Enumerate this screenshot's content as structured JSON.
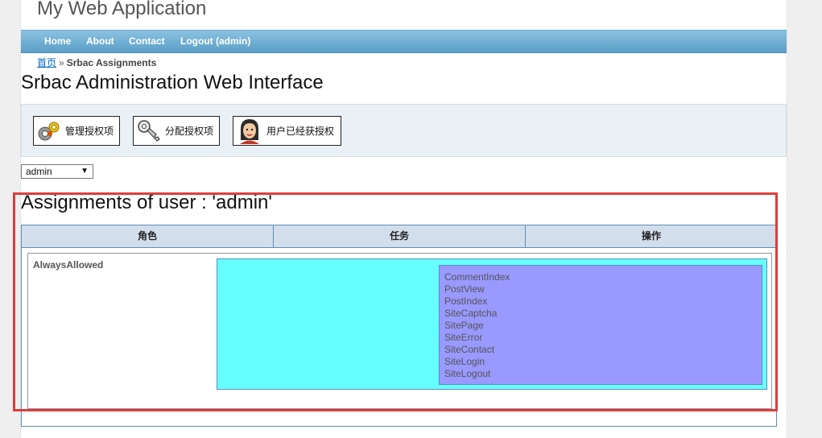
{
  "header": {
    "app_title": "My Web Application"
  },
  "mainmenu": {
    "items": [
      {
        "label": "Home"
      },
      {
        "label": "About"
      },
      {
        "label": "Contact"
      },
      {
        "label": "Logout (admin)"
      }
    ]
  },
  "breadcrumbs": {
    "home": "首页",
    "separator": "»",
    "current": "Srbac Assignments"
  },
  "srbac": {
    "title": "Srbac Administration Web Interface",
    "toolbar": [
      {
        "label": "管理授权项",
        "icon": "gears-icon"
      },
      {
        "label": "分配授权项",
        "icon": "key-icon"
      },
      {
        "label": "用户已经获授权",
        "icon": "user-face-icon"
      }
    ]
  },
  "user_select": {
    "selected": "admin",
    "arrow": "▼"
  },
  "assignments": {
    "title": "Assignments of user : 'admin'",
    "columns": [
      "角色",
      "任务",
      "操作"
    ],
    "role": "AlwaysAllowed",
    "operations": [
      "CommentIndex",
      "PostView",
      "PostIndex",
      "SiteCaptcha",
      "SitePage",
      "SiteError",
      "SiteContact",
      "SiteLogin",
      "SiteLogout"
    ]
  },
  "colors": {
    "menu": "#5a9fc8",
    "header_row": "#d3deec",
    "task_box": "#66ffff",
    "operation_box": "#9999ff",
    "highlight_border": "#e03c3c"
  }
}
